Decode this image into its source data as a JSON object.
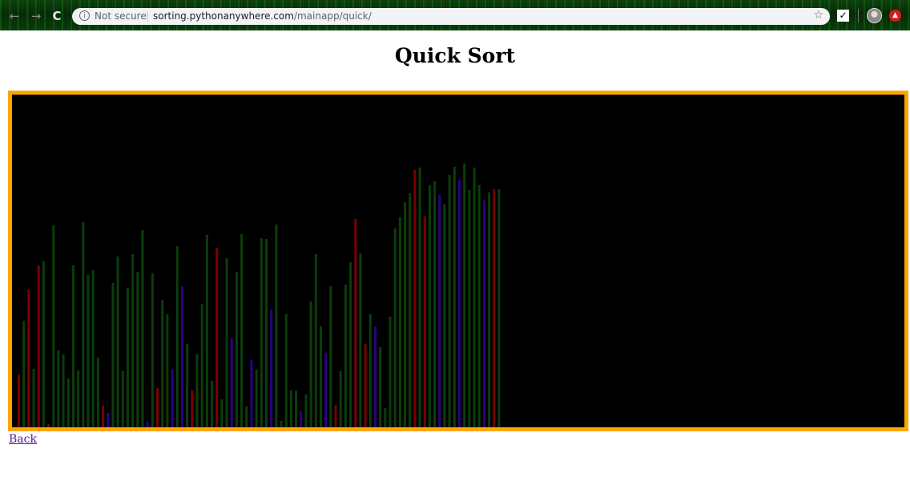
{
  "browser": {
    "security_label": "Not secure",
    "separator": "|",
    "url_host": "sorting.pythonanywhere.com",
    "url_path": "/mainapp/quick/",
    "icons": [
      "back-icon",
      "forward-icon",
      "reload-icon",
      "info-icon",
      "star-icon",
      "todo-extension-icon",
      "profile-avatar",
      "red-extension-icon"
    ]
  },
  "page": {
    "title": "Quick Sort",
    "back_link": "Back"
  },
  "visualization": {
    "background": "#000000",
    "border_color": "#ffa500",
    "colors": {
      "g": "#0b3d0b",
      "r": "#7a0000",
      "b": "#2a0080"
    },
    "bars": [
      {
        "h": 66,
        "c": "r"
      },
      {
        "h": 133,
        "c": "g"
      },
      {
        "h": 172,
        "c": "r"
      },
      {
        "h": 73,
        "c": "g"
      },
      {
        "h": 202,
        "c": "r"
      },
      {
        "h": 207,
        "c": "g"
      },
      {
        "h": 4,
        "c": "r"
      },
      {
        "h": 252,
        "c": "g"
      },
      {
        "h": 96,
        "c": "g"
      },
      {
        "h": 91,
        "c": "g"
      },
      {
        "h": 61,
        "c": "g"
      },
      {
        "h": 202,
        "c": "g"
      },
      {
        "h": 71,
        "c": "g"
      },
      {
        "h": 256,
        "c": "g"
      },
      {
        "h": 190,
        "c": "g"
      },
      {
        "h": 196,
        "c": "g"
      },
      {
        "h": 87,
        "c": "g"
      },
      {
        "h": 27,
        "c": "r"
      },
      {
        "h": 18,
        "c": "b"
      },
      {
        "h": 180,
        "c": "g"
      },
      {
        "h": 213,
        "c": "g"
      },
      {
        "h": 70,
        "c": "g"
      },
      {
        "h": 174,
        "c": "g"
      },
      {
        "h": 216,
        "c": "g"
      },
      {
        "h": 194,
        "c": "g"
      },
      {
        "h": 246,
        "c": "g"
      },
      {
        "h": 7,
        "c": "b"
      },
      {
        "h": 192,
        "c": "g"
      },
      {
        "h": 49,
        "c": "r"
      },
      {
        "h": 159,
        "c": "g"
      },
      {
        "h": 141,
        "c": "g"
      },
      {
        "h": 73,
        "c": "b"
      },
      {
        "h": 226,
        "c": "g"
      },
      {
        "h": 176,
        "c": "b"
      },
      {
        "h": 104,
        "c": "g"
      },
      {
        "h": 46,
        "c": "r"
      },
      {
        "h": 91,
        "c": "g"
      },
      {
        "h": 154,
        "c": "g"
      },
      {
        "h": 240,
        "c": "g"
      },
      {
        "h": 58,
        "c": "g"
      },
      {
        "h": 224,
        "c": "r"
      },
      {
        "h": 35,
        "c": "g"
      },
      {
        "h": 211,
        "c": "g"
      },
      {
        "h": 111,
        "c": "b"
      },
      {
        "h": 194,
        "c": "g"
      },
      {
        "h": 241,
        "c": "g"
      },
      {
        "h": 26,
        "c": "g"
      },
      {
        "h": 84,
        "c": "b"
      },
      {
        "h": 72,
        "c": "g"
      },
      {
        "h": 236,
        "c": "g"
      },
      {
        "h": 235,
        "c": "g"
      },
      {
        "h": 147,
        "c": "b"
      },
      {
        "h": 253,
        "c": "g"
      },
      {
        "h": 8,
        "c": "g"
      },
      {
        "h": 141,
        "c": "g"
      },
      {
        "h": 46,
        "c": "g"
      },
      {
        "h": 46,
        "c": "g"
      },
      {
        "h": 20,
        "c": "b"
      },
      {
        "h": 41,
        "c": "g"
      },
      {
        "h": 157,
        "c": "g"
      },
      {
        "h": 216,
        "c": "g"
      },
      {
        "h": 126,
        "c": "g"
      },
      {
        "h": 93,
        "c": "b"
      },
      {
        "h": 176,
        "c": "g"
      },
      {
        "h": 28,
        "c": "r"
      },
      {
        "h": 70,
        "c": "g"
      },
      {
        "h": 178,
        "c": "g"
      },
      {
        "h": 206,
        "c": "g"
      },
      {
        "h": 260,
        "c": "r"
      },
      {
        "h": 217,
        "c": "g"
      },
      {
        "h": 104,
        "c": "r"
      },
      {
        "h": 141,
        "c": "g"
      },
      {
        "h": 126,
        "c": "b"
      },
      {
        "h": 100,
        "c": "g"
      },
      {
        "h": 24,
        "c": "g"
      },
      {
        "h": 138,
        "c": "g"
      },
      {
        "h": 248,
        "c": "g"
      },
      {
        "h": 262,
        "c": "g"
      },
      {
        "h": 281,
        "c": "g"
      },
      {
        "h": 292,
        "c": "g"
      },
      {
        "h": 321,
        "c": "r"
      },
      {
        "h": 324,
        "c": "g"
      },
      {
        "h": 263,
        "c": "r"
      },
      {
        "h": 302,
        "c": "g"
      },
      {
        "h": 307,
        "c": "g"
      },
      {
        "h": 290,
        "c": "b"
      },
      {
        "h": 278,
        "c": "g"
      },
      {
        "h": 315,
        "c": "g"
      },
      {
        "h": 325,
        "c": "g"
      },
      {
        "h": 309,
        "c": "b"
      },
      {
        "h": 329,
        "c": "g"
      },
      {
        "h": 296,
        "c": "g"
      },
      {
        "h": 324,
        "c": "g"
      },
      {
        "h": 302,
        "c": "g"
      },
      {
        "h": 283,
        "c": "b"
      },
      {
        "h": 293,
        "c": "g"
      },
      {
        "h": 297,
        "c": "r"
      },
      {
        "h": 297,
        "c": "g"
      }
    ]
  }
}
